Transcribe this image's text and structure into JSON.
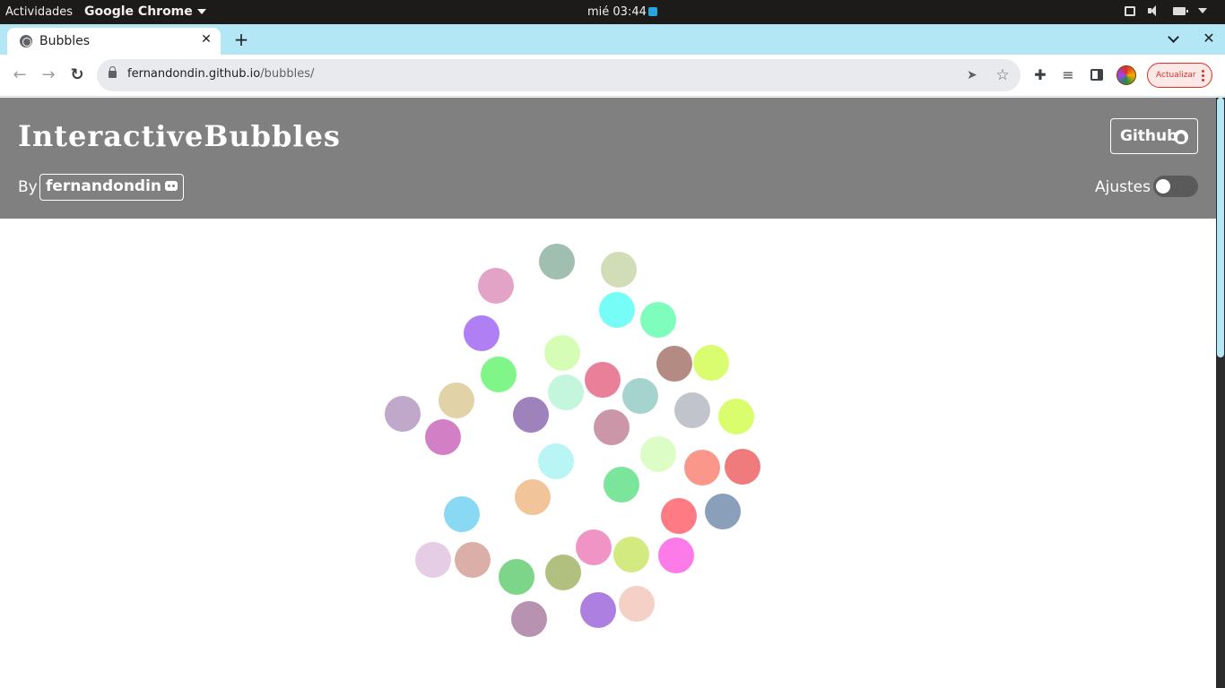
{
  "system_bar": {
    "activities": "Actividades",
    "app_menu": "Google Chrome",
    "clock": "mié 03:44"
  },
  "tab": {
    "title": "Bubbles",
    "close": "✕"
  },
  "new_tab": "+",
  "window_close": "✕",
  "toolbar": {
    "back": "←",
    "forward": "→",
    "reload": "↻",
    "url_host": "fernandondin.github.io",
    "url_path": "/bubbles/",
    "send": "➤",
    "star": "☆",
    "extensions": "✚",
    "media": "≡",
    "update_label": "Actualizar"
  },
  "site": {
    "brand": "InteractiveBubbles",
    "by": "By",
    "author": "fernandondin",
    "github": "Github",
    "settings": "Ajustes",
    "settings_toggle_on": false
  },
  "bubbles": [
    {
      "color": "#a1bfb0"
    },
    {
      "color": "#d0ddb7"
    },
    {
      "color": "#e2a3c7"
    },
    {
      "color": "#77fdf7"
    },
    {
      "color": "#7ffdbd"
    },
    {
      "color": "#b17ff4"
    },
    {
      "color": "#d6fdb6"
    },
    {
      "color": "#b48b83"
    },
    {
      "color": "#dafd6f"
    },
    {
      "color": "#7ff687"
    },
    {
      "color": "#ea7f9a"
    },
    {
      "color": "#c4f6dd"
    },
    {
      "color": "#a5d4cf"
    },
    {
      "color": "#bfa8ca"
    },
    {
      "color": "#e2d2a7"
    },
    {
      "color": "#9e82bb"
    },
    {
      "color": "#c2c4cb"
    },
    {
      "color": "#dafd6d"
    },
    {
      "color": "#d27fc6"
    },
    {
      "color": "#cb97a8"
    },
    {
      "color": "#b8f5f4"
    },
    {
      "color": "#ddfdc6"
    },
    {
      "color": "#fa978a"
    },
    {
      "color": "#f07b7c"
    },
    {
      "color": "#f1c49a"
    },
    {
      "color": "#7be59c"
    },
    {
      "color": "#8ad9f4"
    },
    {
      "color": "#fe7b83"
    },
    {
      "color": "#899fba"
    },
    {
      "color": "#f094c6"
    },
    {
      "color": "#d3ea80"
    },
    {
      "color": "#fd7be9"
    },
    {
      "color": "#e5cde5"
    },
    {
      "color": "#dcaea8"
    },
    {
      "color": "#7dd589"
    },
    {
      "color": "#b1c07e"
    },
    {
      "color": "#ad7fe1"
    },
    {
      "color": "#f4d0c6"
    },
    {
      "color": "#b892b1"
    }
  ]
}
